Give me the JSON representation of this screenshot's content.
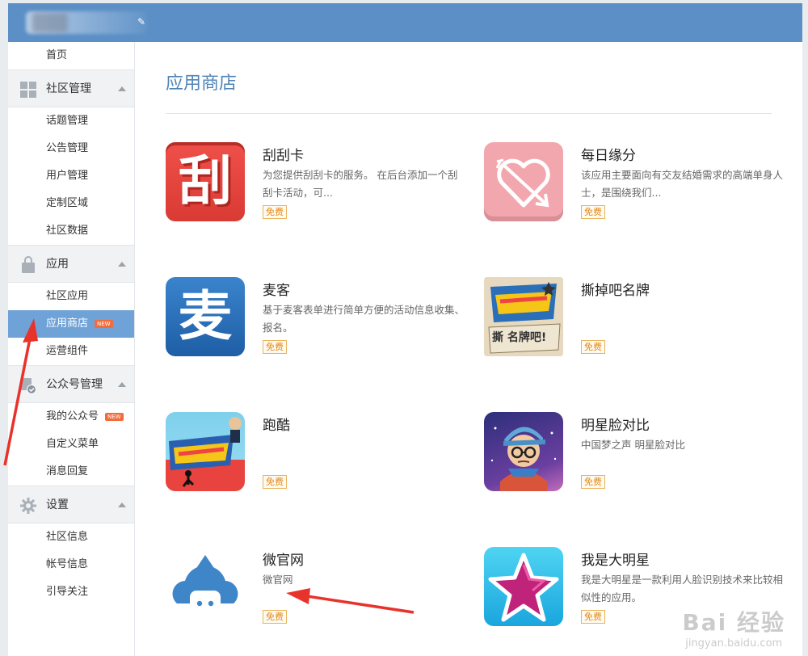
{
  "sidebar": {
    "home": "首页",
    "groups": [
      {
        "label": "社区管理",
        "icon": "grid-icon",
        "items": [
          "话题管理",
          "公告管理",
          "用户管理",
          "定制区域",
          "社区数据"
        ]
      },
      {
        "label": "应用",
        "icon": "bag-icon",
        "items": [
          "社区应用",
          "应用商店",
          "运营组件"
        ]
      },
      {
        "label": "公众号管理",
        "icon": "account-check-icon",
        "items": [
          "我的公众号",
          "自定义菜单",
          "消息回复"
        ]
      },
      {
        "label": "设置",
        "icon": "gear-icon",
        "items": [
          "社区信息",
          "帐号信息",
          "引导关注"
        ]
      }
    ],
    "new_badge": "NEW"
  },
  "main": {
    "title": "应用商店",
    "apps": [
      {
        "name": "刮刮卡",
        "desc": "为您提供刮刮卡的服务。 在后台添加一个刮刮卡活动，可...",
        "tag": "免费",
        "icon": "scratch-card-icon",
        "icon_text": "刮"
      },
      {
        "name": "每日缘分",
        "desc": "该应用主要面向有交友结婚需求的高端单身人士，是围绕我们...",
        "tag": "免费",
        "icon": "heart-arrow-icon"
      },
      {
        "name": "麦客",
        "desc": "基于麦客表单进行简单方便的活动信息收集、报名。",
        "tag": "免费",
        "icon": "maike-icon",
        "icon_text": "麦"
      },
      {
        "name": "撕掉吧名牌",
        "desc": "",
        "tag": "免费",
        "icon": "running-man-nametag-icon",
        "icon_text": "撕 名牌吧!"
      },
      {
        "name": "跑酷",
        "desc": "",
        "tag": "免费",
        "icon": "running-man-parkour-icon"
      },
      {
        "name": "明星脸对比",
        "desc": "中国梦之声 明星脸对比",
        "tag": "免费",
        "icon": "star-face-icon"
      },
      {
        "name": "微官网",
        "desc": "微官网",
        "tag": "免费",
        "icon": "cloud-house-icon"
      },
      {
        "name": "我是大明星",
        "desc": "我是大明星是一款利用人脸识别技术来比较相似性的应用。",
        "tag": "免费",
        "icon": "big-star-icon"
      }
    ]
  },
  "watermark": {
    "top": "Bai 经验",
    "bottom": "jingyan.baidu.com"
  },
  "colors": {
    "header": "#5b8fc6",
    "active": "#6fa2d6",
    "title": "#4f84b8",
    "tag": "#e08a1a",
    "arrow": "#e8332b"
  }
}
